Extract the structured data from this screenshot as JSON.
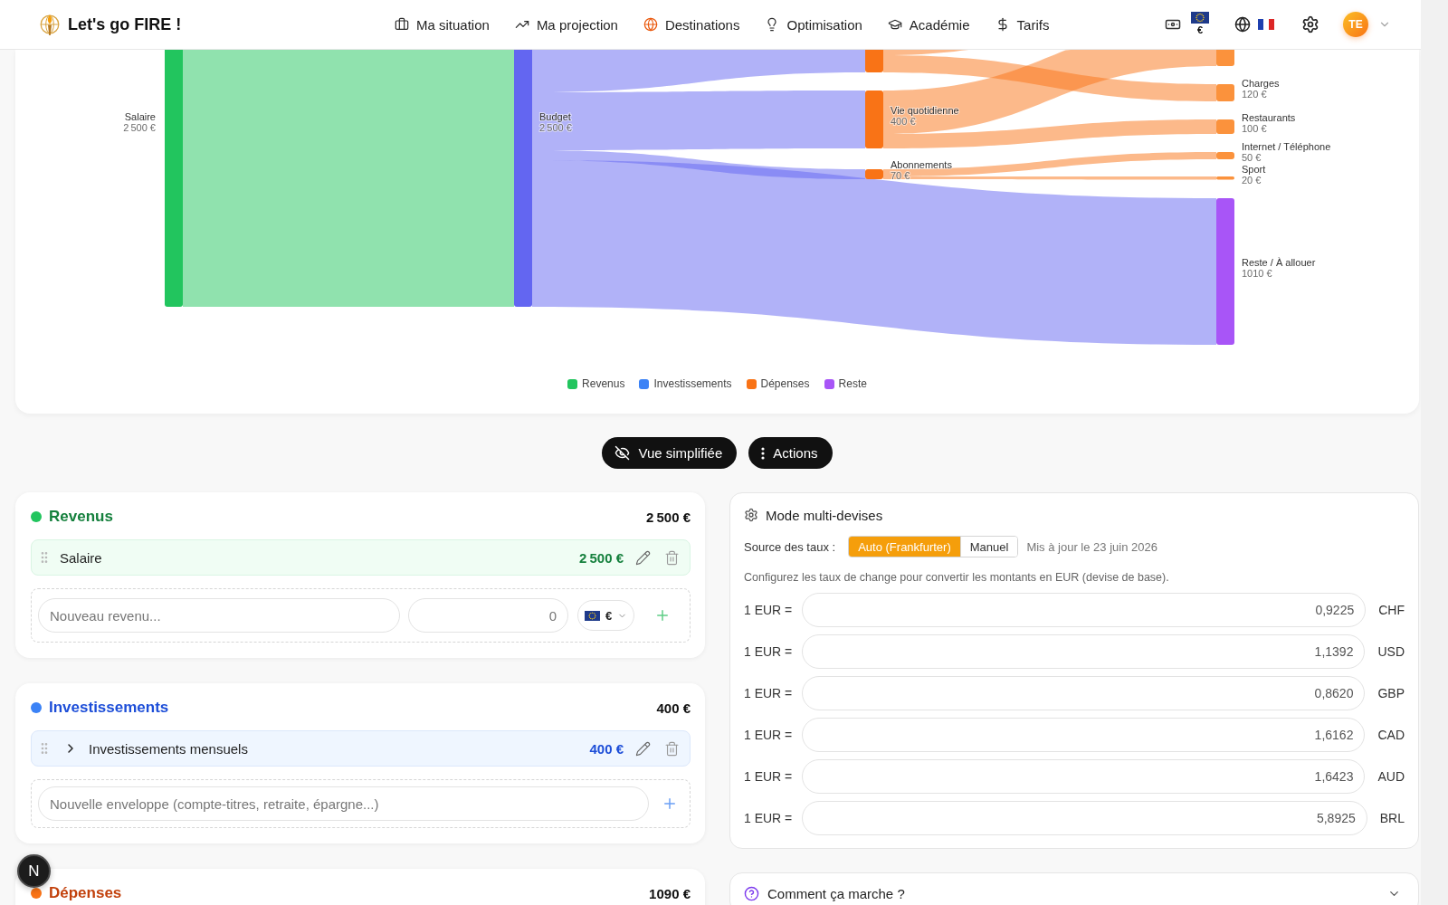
{
  "header": {
    "brand": "Let's go FIRE !",
    "nav": [
      {
        "label": "Ma situation",
        "selected": false
      },
      {
        "label": "Ma projection",
        "selected": false
      },
      {
        "label": "Destinations",
        "selected": true
      },
      {
        "label": "Optimisation",
        "selected": false
      },
      {
        "label": "Académie",
        "selected": false
      },
      {
        "label": "Tarifs",
        "selected": false
      }
    ],
    "currency": "€",
    "avatar": "TE"
  },
  "flow_chart": {
    "nodes": [
      {
        "label": "Salaire",
        "amount": "2 500 €",
        "color": "#22c55e"
      },
      {
        "label": "Budget",
        "amount": "2 500 €",
        "color": "#6366f1"
      },
      {
        "color": "#f97316"
      },
      {
        "label": "Vie quotidienne",
        "amount": "400 €",
        "color": "#f97316"
      },
      {
        "label": "Abonnements",
        "amount": "70 €",
        "color": "#f97316"
      },
      {
        "color": "#fb923c"
      },
      {
        "label": "Charges",
        "amount": "120 €",
        "color": "#fb923c"
      },
      {
        "label": "Restaurants",
        "amount": "100 €",
        "color": "#fb923c"
      },
      {
        "label": "Internet / Téléphone",
        "amount": "50 €",
        "color": "#fb923c"
      },
      {
        "label": "Sport",
        "amount": "20 €",
        "color": "#fb923c"
      },
      {
        "label": "Reste / À allouer",
        "amount": "1010 €",
        "color": "#a855f7"
      }
    ],
    "legend": [
      {
        "label": "Revenus",
        "color": "#22c55e"
      },
      {
        "label": "Investissements",
        "color": "#3b82f6"
      },
      {
        "label": "Dépenses",
        "color": "#f97316"
      },
      {
        "label": "Reste",
        "color": "#a855f7"
      }
    ]
  },
  "view_buttons": [
    "Vue simplifiée",
    "Actions"
  ],
  "sections": [
    {
      "kind": "income",
      "title": "Revenus",
      "total": "2 500 €",
      "color": "#22c55e",
      "items": [
        {
          "name": "Salaire",
          "amount": "2 500 €"
        }
      ],
      "new_item": {
        "placeholder": "Nouveau revenu...",
        "amount_placeholder": "0",
        "currency": "€"
      }
    },
    {
      "kind": "investment",
      "title": "Investissements",
      "total": "400 €",
      "color": "#3b82f6",
      "items": [
        {
          "name": "Investissements mensuels",
          "amount": "400 €",
          "expanded": false
        }
      ],
      "new_item": {
        "placeholder": "Nouvelle enveloppe (compte-titres, retraite, épargne...)"
      }
    },
    {
      "kind": "expense",
      "title": "Dépenses",
      "total": "1090 €",
      "color": "#f97316"
    }
  ],
  "multi_currency": {
    "title": "Mode multi-devises",
    "source_label": "Source des taux :",
    "sources": [
      {
        "label": "Auto (Frankfurter)",
        "selected": true
      },
      {
        "label": "Manuel",
        "selected": false
      }
    ],
    "updated": "Mis à jour le 23 juin 2026",
    "description": "Configurez les taux de change pour convertir les montants en EUR (devise de base).",
    "rates": [
      {
        "base": "1 EUR =",
        "value": "0,9225",
        "currency": "CHF"
      },
      {
        "base": "1 EUR =",
        "value": "1,1392",
        "currency": "USD"
      },
      {
        "base": "1 EUR =",
        "value": "0,8620",
        "currency": "GBP"
      },
      {
        "base": "1 EUR =",
        "value": "1,6162",
        "currency": "CAD"
      },
      {
        "base": "1 EUR =",
        "value": "1,6423",
        "currency": "AUD"
      },
      {
        "base": "1 EUR =",
        "value": "5,8925",
        "currency": "BRL"
      }
    ]
  },
  "help": {
    "title": "Comment ça marche ?",
    "expanded": false
  },
  "dev_badge": "N"
}
